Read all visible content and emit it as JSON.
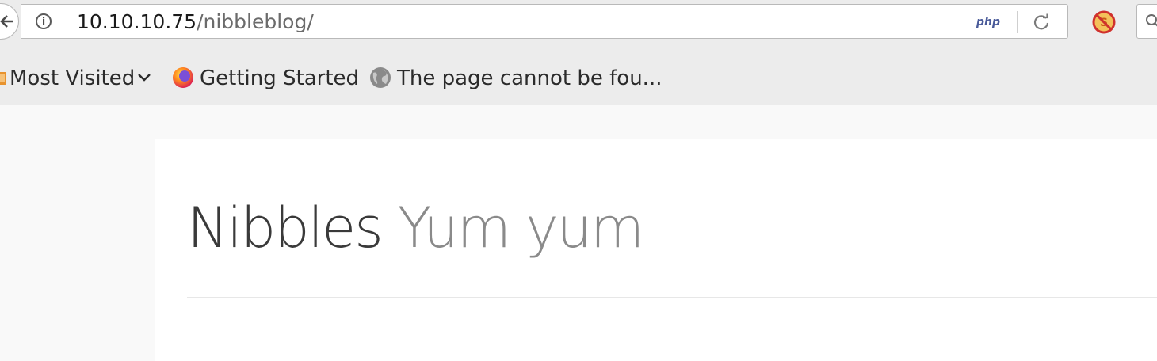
{
  "browser": {
    "url_host": "10.10.10.75",
    "url_path": "/nibbleblog/",
    "php_badge": "php",
    "info_glyph": "i",
    "bookmarks": [
      {
        "label": "Most Visited",
        "icon": "folder-icon",
        "has_dropdown": true
      },
      {
        "label": "Getting Started",
        "icon": "firefox-icon"
      },
      {
        "label": "The page cannot be fou...",
        "icon": "globe-icon"
      }
    ]
  },
  "blog": {
    "name": "Nibbles",
    "slogan": "Yum yum"
  },
  "colors": {
    "chrome_bg": "#ececec",
    "page_bg": "#f9f9f9",
    "title_color": "#3a3a3a",
    "slogan_color": "#8a8a8a",
    "php_badge": "#4a5b9a"
  }
}
